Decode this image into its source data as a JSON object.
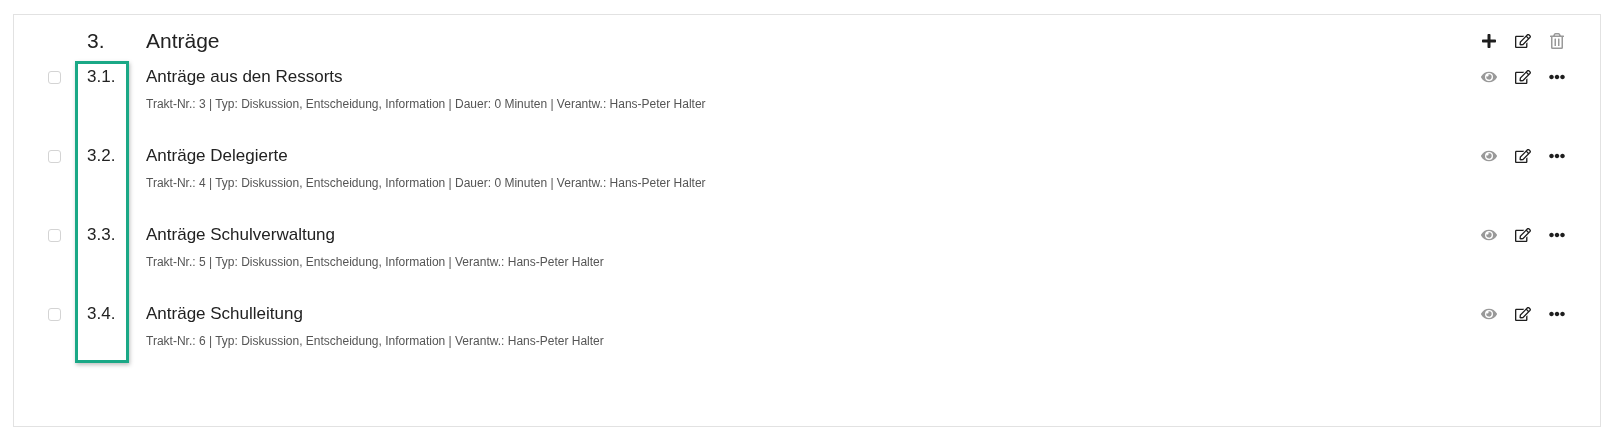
{
  "section": {
    "number": "3.",
    "title": "Anträge",
    "actions": [
      {
        "kind": "add",
        "disabled": false
      },
      {
        "kind": "edit",
        "disabled": false
      },
      {
        "kind": "delete",
        "disabled": true
      }
    ]
  },
  "items": [
    {
      "checked": false,
      "number": "3.1.",
      "title": "Anträge aus den Ressorts",
      "meta": "Trakt-Nr.: 3 | Typ: Diskussion, Entscheidung, Information | Dauer: 0 Minuten | Verantw.: Hans-Peter Halter"
    },
    {
      "checked": false,
      "number": "3.2.",
      "title": "Anträge Delegierte",
      "meta": "Trakt-Nr.: 4 | Typ: Diskussion, Entscheidung, Information | Dauer: 0 Minuten | Verantw.: Hans-Peter Halter"
    },
    {
      "checked": false,
      "number": "3.3.",
      "title": "Anträge Schulverwaltung",
      "meta": "Trakt-Nr.: 5 | Typ: Diskussion, Entscheidung, Information | Verantw.: Hans-Peter Halter"
    },
    {
      "checked": false,
      "number": "3.4.",
      "title": "Anträge Schulleitung",
      "meta": "Trakt-Nr.: 6 | Typ: Diskussion, Entscheidung, Information | Verantw.: Hans-Peter Halter"
    }
  ],
  "item_actions": [
    {
      "kind": "view",
      "disabled": true
    },
    {
      "kind": "edit",
      "disabled": false
    },
    {
      "kind": "more",
      "disabled": false
    }
  ]
}
